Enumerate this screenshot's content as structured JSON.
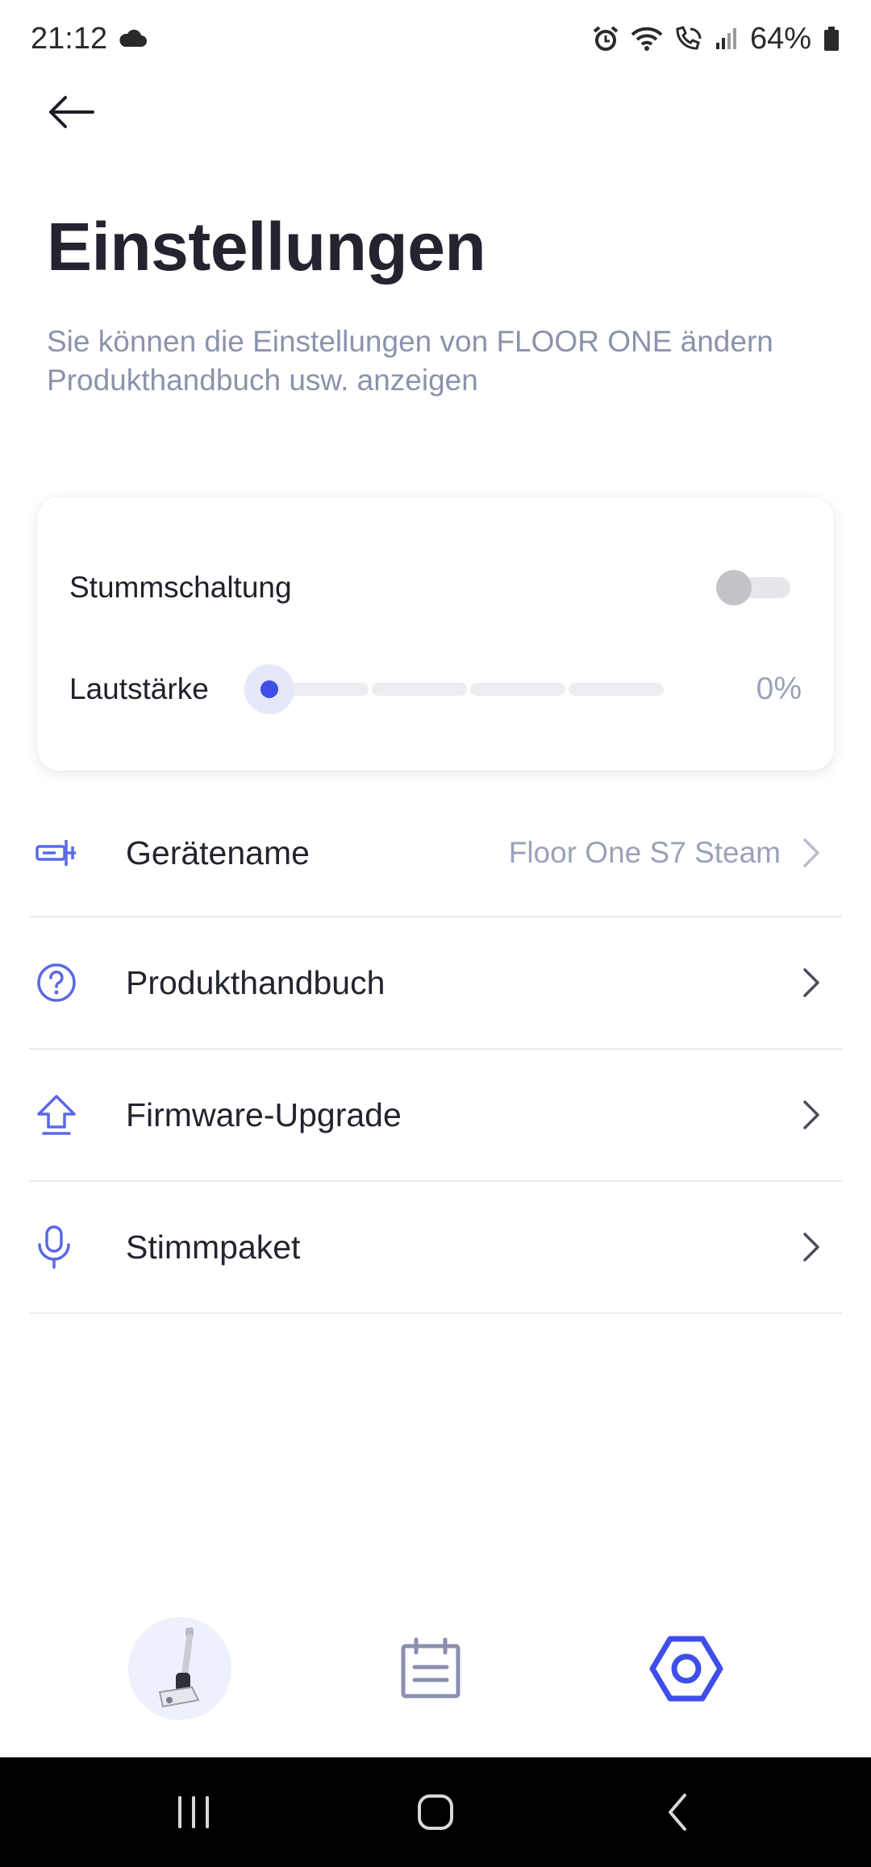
{
  "status_bar": {
    "time": "21:12",
    "battery": "64%",
    "icons": [
      "cloud-icon",
      "alarm-icon",
      "wifi-icon",
      "wifi-call-icon",
      "signal-icon",
      "battery-icon"
    ]
  },
  "header": {
    "title": "Einstellungen",
    "subtitle": "Sie können die Einstellungen von FLOOR ONE ändern Produkthandbuch usw. anzeigen"
  },
  "sound": {
    "mute_label": "Stummschaltung",
    "mute_enabled": false,
    "volume_label": "Lautstärke",
    "volume_value": "0%",
    "volume_level": 0
  },
  "menu": [
    {
      "label": "Gerätename",
      "value": "Floor One S7 Steam",
      "icon": "device-name-icon"
    },
    {
      "label": "Produkthandbuch",
      "value": "",
      "icon": "help-circle-icon"
    },
    {
      "label": "Firmware-Upgrade",
      "value": "",
      "icon": "upgrade-arrow-icon"
    },
    {
      "label": "Stimmpaket",
      "value": "",
      "icon": "microphone-icon"
    }
  ],
  "tabs": [
    {
      "name": "device",
      "icon": "vacuum-device-icon"
    },
    {
      "name": "schedule",
      "icon": "calendar-icon"
    },
    {
      "name": "settings",
      "icon": "settings-hex-icon",
      "active": true
    }
  ],
  "colors": {
    "accent": "#3f4ee8",
    "subtitle": "#8a93ab",
    "icon_blue": "#5a68e8"
  }
}
